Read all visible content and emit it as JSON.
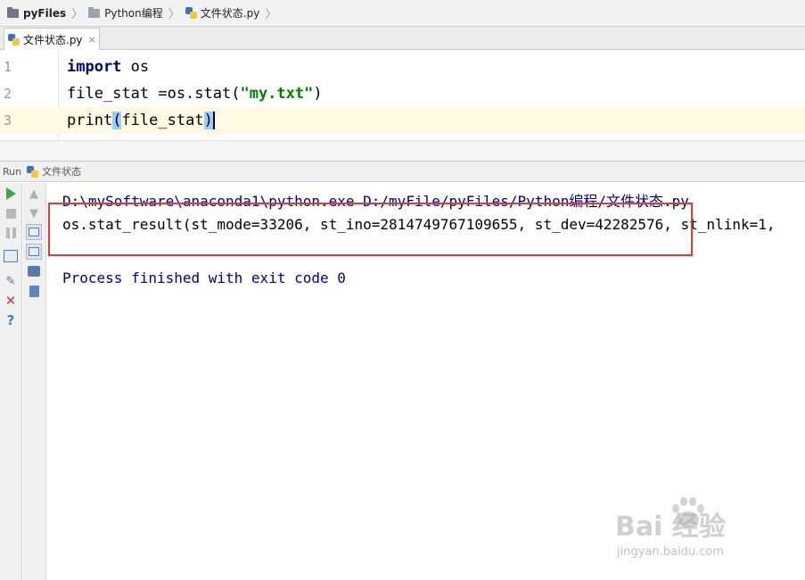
{
  "breadcrumb": {
    "items": [
      "pyFiles",
      "Python编程",
      "文件状态.py"
    ]
  },
  "editor": {
    "tab": {
      "label": "文件状态.py",
      "close": "×"
    },
    "lines": [
      {
        "number": "1",
        "keyword": "import",
        "rest": " os"
      },
      {
        "number": "2",
        "pre": "file_stat =os.stat(",
        "string": "\"my.txt\"",
        "post": ")"
      },
      {
        "number": "3",
        "fn": "print",
        "open": "(",
        "arg": "file_stat",
        "close": ")"
      }
    ]
  },
  "run_panel": {
    "label": "Run",
    "config_name": "文件状态",
    "output": {
      "command": "D:\\mySoftware\\anaconda1\\python.exe D:/myFile/pyFiles/Python编程/文件状态.py",
      "result": "os.stat_result(st_mode=33206, st_ino=2814749767109655, st_dev=42282576, st_nlink=1,",
      "exit_message": "Process finished with exit code 0"
    }
  },
  "watermark": {
    "brand": "Bai  经验",
    "url": "jingyan.baidu.com"
  },
  "colors": {
    "keyword": "#000080",
    "string": "#008000",
    "highlight_box": "#e53935",
    "current_line": "#fffae3"
  },
  "icons": [
    "folder-icon",
    "python-file-icon",
    "play-icon",
    "stop-icon",
    "pause-icon",
    "close-icon",
    "help-icon",
    "trash-icon",
    "print-icon",
    "paw-icon"
  ]
}
